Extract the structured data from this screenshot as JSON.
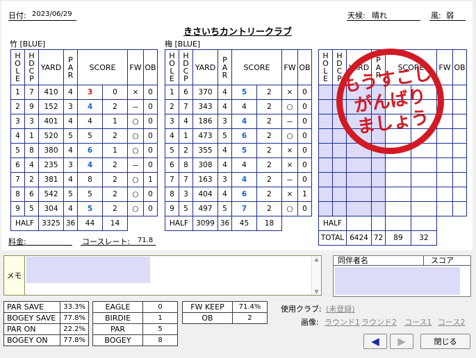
{
  "header": {
    "date_label": "日付:",
    "date": "2023/06/29",
    "title": "きさいちカントリークラブ",
    "weather_label": "天候:",
    "weather": "晴れ",
    "wind_label": "風:",
    "wind": "弱"
  },
  "course1": {
    "name": "竹 [BLUE]",
    "headers": [
      "HOLE",
      "HDCP",
      "YARD",
      "PAR",
      "SCORE",
      "",
      "FW",
      "OB"
    ],
    "rows": [
      [
        "1",
        "7",
        "410",
        "4",
        "3",
        "0",
        "×",
        "0"
      ],
      [
        "2",
        "9",
        "152",
        "3",
        "4",
        "2",
        "－",
        "0"
      ],
      [
        "3",
        "3",
        "401",
        "4",
        "4",
        "1",
        "○",
        "0"
      ],
      [
        "4",
        "1",
        "520",
        "5",
        "5",
        "2",
        "○",
        "0"
      ],
      [
        "5",
        "8",
        "380",
        "4",
        "6",
        "1",
        "○",
        "0"
      ],
      [
        "6",
        "4",
        "235",
        "3",
        "4",
        "2",
        "－",
        "0"
      ],
      [
        "7",
        "2",
        "381",
        "4",
        "8",
        "2",
        "○",
        "1"
      ],
      [
        "8",
        "6",
        "542",
        "5",
        "5",
        "2",
        "○",
        "0"
      ],
      [
        "9",
        "5",
        "304",
        "4",
        "5",
        "2",
        "○",
        "0"
      ]
    ],
    "half": [
      "HALF",
      "3325",
      "36",
      "44",
      "14"
    ]
  },
  "course2": {
    "name": "梅 [BLUE]",
    "headers": [
      "HOLE",
      "HDCP",
      "YARD",
      "PAR",
      "SCORE",
      "",
      "FW",
      "OB"
    ],
    "rows": [
      [
        "1",
        "6",
        "370",
        "4",
        "5",
        "2",
        "×",
        "0"
      ],
      [
        "2",
        "7",
        "343",
        "4",
        "4",
        "2",
        "○",
        "0"
      ],
      [
        "3",
        "4",
        "186",
        "3",
        "4",
        "2",
        "－",
        "0"
      ],
      [
        "4",
        "1",
        "473",
        "5",
        "6",
        "2",
        "○",
        "0"
      ],
      [
        "5",
        "2",
        "355",
        "4",
        "5",
        "2",
        "×",
        "0"
      ],
      [
        "6",
        "8",
        "308",
        "4",
        "4",
        "2",
        "×",
        "0"
      ],
      [
        "7",
        "7",
        "163",
        "3",
        "4",
        "2",
        "－",
        "0"
      ],
      [
        "8",
        "3",
        "404",
        "4",
        "6",
        "2",
        "×",
        "1"
      ],
      [
        "9",
        "5",
        "497",
        "5",
        "7",
        "2",
        "○",
        "0"
      ]
    ],
    "half": [
      "HALF",
      "3099",
      "36",
      "45",
      "18"
    ]
  },
  "course3": {
    "headers": [
      "HOLE",
      "HDCP",
      "YARD",
      "PAR",
      "SCORE",
      "",
      "FW",
      "OB"
    ],
    "half_label": "HALF",
    "total": [
      "TOTAL",
      "6424",
      "72",
      "89",
      "32"
    ]
  },
  "stamp": {
    "line1": "もうすこし",
    "line2": "がんばり",
    "line3": "ましょう"
  },
  "footer": {
    "fee_label": "料金:",
    "rating_label": "コースレート:",
    "rating": "71.8"
  },
  "memo": {
    "label": "メモ"
  },
  "companions": {
    "col1": "同伴者名",
    "col2": "スコア"
  },
  "stats1": [
    [
      "PAR SAVE",
      "33.3%"
    ],
    [
      "BOGEY SAVE",
      "77.8%"
    ],
    [
      "PAR ON",
      "22.2%"
    ],
    [
      "BOGEY ON",
      "77.8%"
    ]
  ],
  "stats2": [
    [
      "EAGLE",
      "0"
    ],
    [
      "BIRDIE",
      "1"
    ],
    [
      "PAR",
      "5"
    ],
    [
      "BOGEY",
      "8"
    ]
  ],
  "stats3": [
    [
      "FW KEEP",
      "71.4%"
    ],
    [
      "OB",
      "2"
    ]
  ],
  "links": {
    "club_label": "使用クラブ:",
    "club_link": "(未登録)",
    "image_label": "画像:",
    "round1": "ラウンド1",
    "round2": "ラウンド2",
    "course1": "コース1",
    "course2": "コース2"
  },
  "buttons": {
    "close": "閉じる"
  },
  "colors": {
    "grid": "#1c2c8c",
    "stamp": "#d21a24",
    "highlight": "#dcdcf8",
    "red_score": "#d01818",
    "blue_score": "#1466cc"
  }
}
